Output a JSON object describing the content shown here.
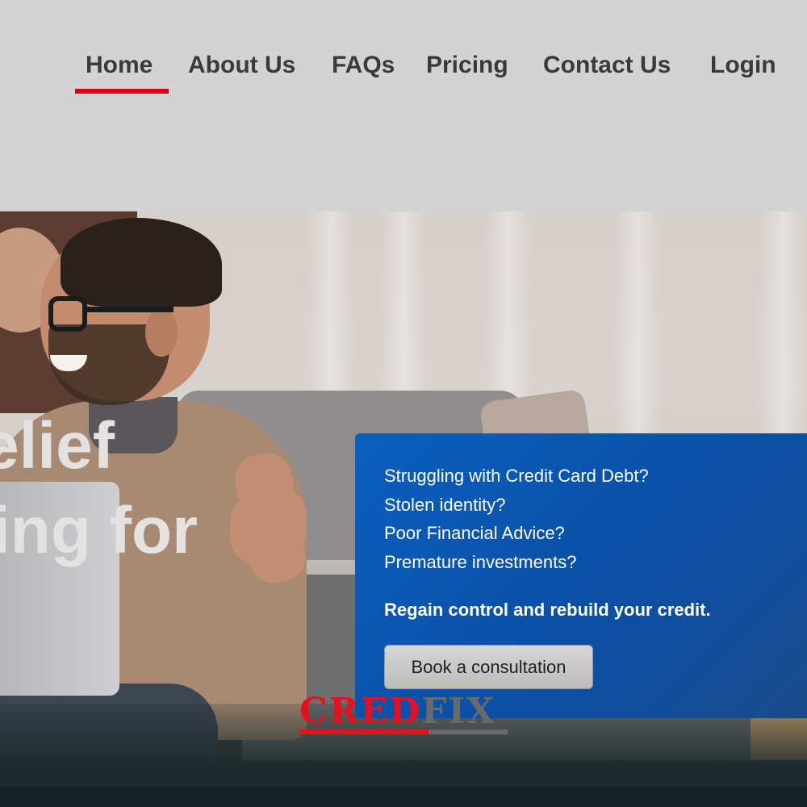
{
  "nav": {
    "items": [
      {
        "label": "Home",
        "active": true
      },
      {
        "label": "About Us"
      },
      {
        "label": "FAQs"
      },
      {
        "label": "Pricing"
      },
      {
        "label": "Contact Us"
      },
      {
        "label": "Login"
      }
    ],
    "active_color": "#d9001b"
  },
  "hero": {
    "headline_line1": "elief",
    "headline_line2": "ing for"
  },
  "card": {
    "questions": [
      "Struggling with Credit Card Debt?",
      "Stolen identity?",
      "Poor Financial Advice?",
      "Premature investments?"
    ],
    "tagline": "Regain control and rebuild your credit.",
    "cta_label": "Book a consultation",
    "background_color": "#0b5fc0"
  },
  "logo": {
    "part1": "CRED",
    "part2": "FIX",
    "color1": "#e8101e",
    "color2": "#6a6a6a"
  }
}
